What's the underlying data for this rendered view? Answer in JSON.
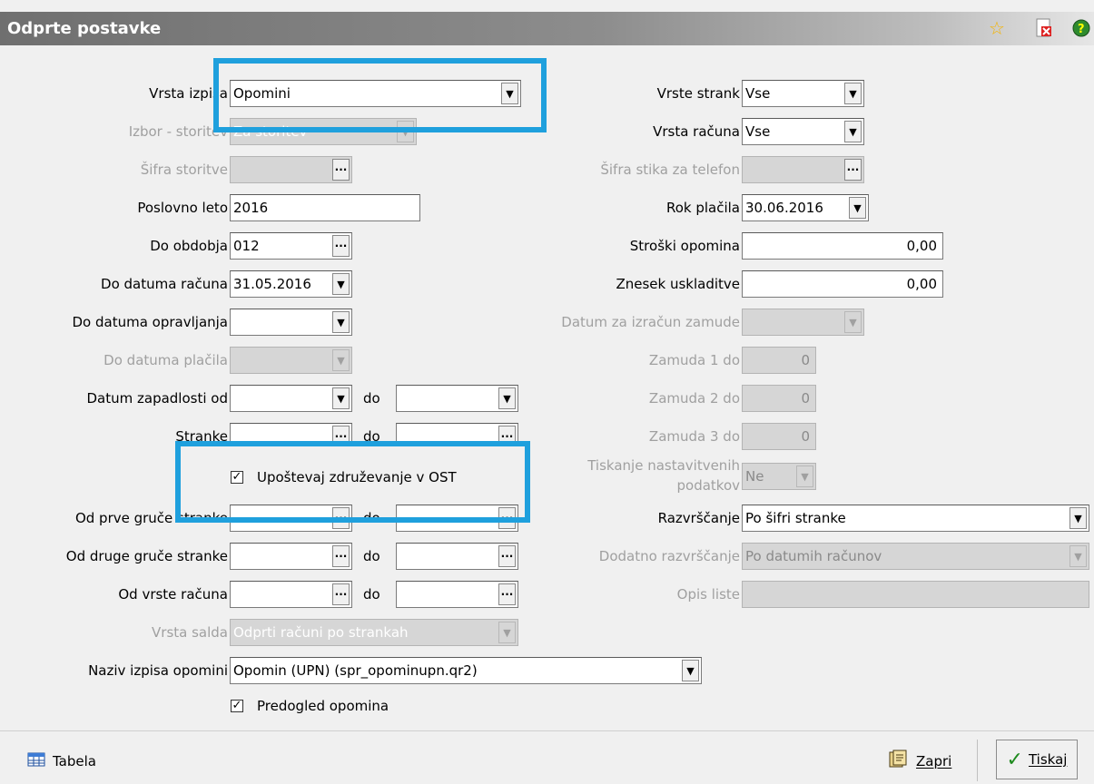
{
  "window": {
    "title": "Odprte postavke"
  },
  "icons": {
    "favorite": "star-icon",
    "pdf": "pdf-close-icon",
    "help": "help-icon"
  },
  "left": {
    "vrsta_izpisa": {
      "label": "Vrsta izpisa",
      "value": "Opomini"
    },
    "izbor_storitev": {
      "label": "Izbor - storitev",
      "value": "Za storitev"
    },
    "sifra_storitve": {
      "label": "Šifra storitve",
      "value": ""
    },
    "poslovno_leto": {
      "label": "Poslovno leto",
      "value": "2016"
    },
    "do_obdobja": {
      "label": "Do obdobja",
      "value": "012"
    },
    "do_datuma_racuna": {
      "label": "Do datuma računa",
      "value": "31.05.2016"
    },
    "do_datuma_opravljanja": {
      "label": "Do datuma opravljanja",
      "value": ""
    },
    "do_datuma_placila": {
      "label": "Do datuma plačila",
      "value": ""
    },
    "datum_zapadlosti": {
      "label": "Datum zapadlosti od",
      "to_label": "do",
      "from": "",
      "to": ""
    },
    "stranke": {
      "label": "Stranke",
      "to_label": "do",
      "from": "",
      "to": ""
    },
    "upostevaj": {
      "label": "Upoštevaj združevanje v OST",
      "checked": true
    },
    "prva_gruca": {
      "label": "Od prve gruče stranke",
      "to_label": "do",
      "from": "",
      "to": ""
    },
    "druga_gruca": {
      "label": "Od druge gruče stranke",
      "to_label": "do",
      "from": "",
      "to": ""
    },
    "vrsta_racuna": {
      "label": "Od vrste računa",
      "to_label": "do",
      "from": "",
      "to": ""
    },
    "vrsta_salda": {
      "label": "Vrsta salda",
      "value": "Odprti računi po strankah"
    },
    "naziv_izpisa": {
      "label": "Naziv izpisa opomini",
      "value": "Opomin (UPN)  (spr_opominupn.qr2)"
    },
    "predogled": {
      "label": "Predogled opomina",
      "checked": true
    }
  },
  "right": {
    "vrste_strank": {
      "label": "Vrste strank",
      "value": "Vse"
    },
    "vrsta_racuna": {
      "label": "Vrsta računa",
      "value": "Vse"
    },
    "sifra_stika": {
      "label": "Šifra stika za telefon",
      "value": ""
    },
    "rok_placila": {
      "label": "Rok plačila",
      "value": "30.06.2016"
    },
    "stroski_opomina": {
      "label": "Stroški opomina",
      "value": "0,00"
    },
    "znesek_uskladitve": {
      "label": "Znesek uskladitve",
      "value": "0,00"
    },
    "datum_zamude": {
      "label": "Datum za izračun zamude",
      "value": ""
    },
    "zamuda1": {
      "label": "Zamuda 1 do",
      "value": "0"
    },
    "zamuda2": {
      "label": "Zamuda 2 do",
      "value": "0"
    },
    "zamuda3": {
      "label": "Zamuda 3 do",
      "value": "0"
    },
    "tiskanje": {
      "label1": "Tiskanje nastavitvenih",
      "label2": "podatkov",
      "value": "Ne"
    },
    "razvrscanje": {
      "label": "Razvrščanje",
      "value": "Po šifri stranke"
    },
    "dodatno": {
      "label": "Dodatno razvrščanje",
      "value": "Po datumih računov"
    },
    "opis_liste": {
      "label": "Opis liste",
      "value": ""
    }
  },
  "footer": {
    "tabela": "Tabela",
    "zapri": "Zapri",
    "tiskaj": "Tiskaj"
  }
}
